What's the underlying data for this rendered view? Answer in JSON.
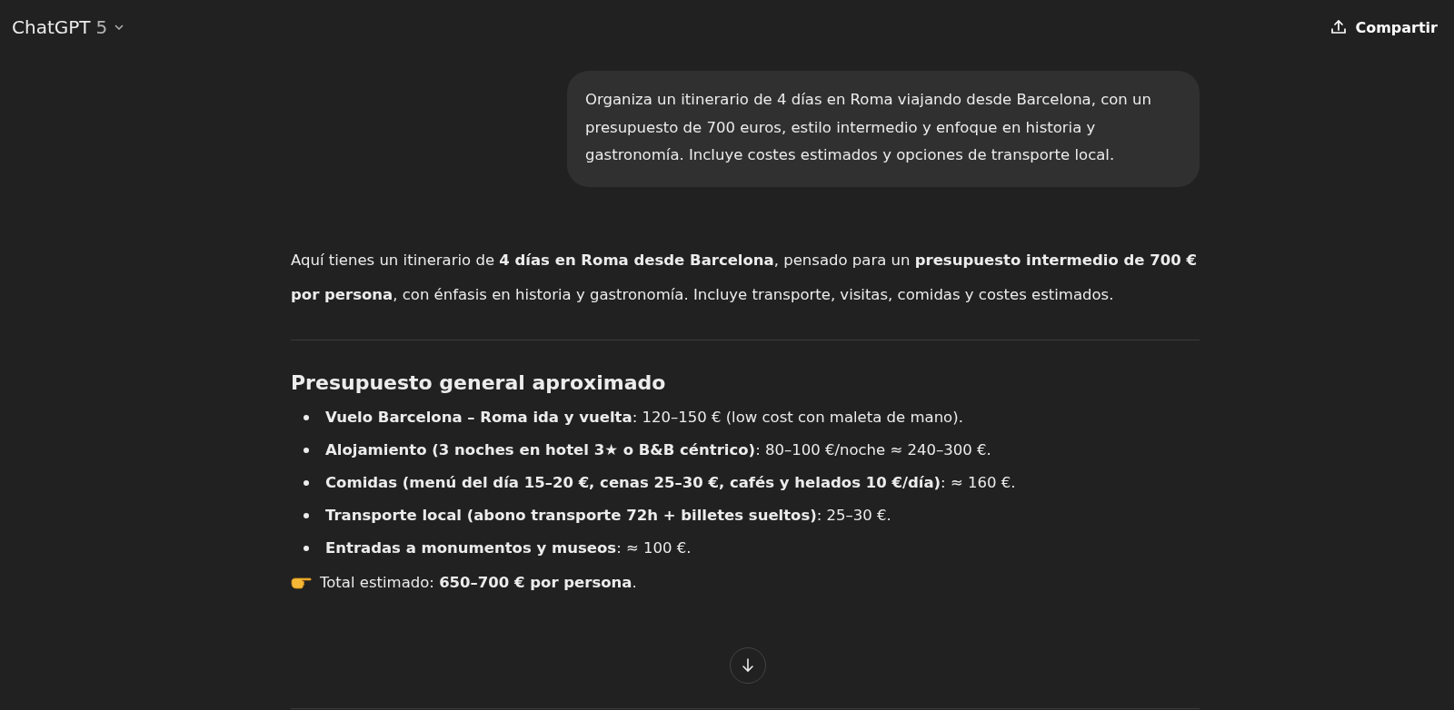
{
  "header": {
    "model_name": "ChatGPT",
    "model_version": "5",
    "share_button": "Compartir"
  },
  "user_message": "Organiza un itinerario de 4 días en Roma viajando desde Barcelona, con un presupuesto de 700 euros, estilo intermedio y enfoque en historia y gastronomía. Incluye costes estimados y opciones de transporte local.",
  "assistant_message": {
    "intro": "Aquí tienes un itinerario de **4 días en Roma desde Barcelona**, pensado para un **presupuesto intermedio de 700 € por persona**, con énfasis en historia y gastronomía. Incluye transporte, visitas, comidas y costes estimados.",
    "section_title": "Presupuesto general aproximado",
    "items": [
      "**Vuelo Barcelona – Roma ida y vuelta**: 120–150 € (low cost con maleta de mano).",
      "**Alojamiento (3 noches en hotel 3★ o B&B céntrico)**: 80–100 €/noche ≈ 240–300 €.",
      "**Comidas (menú del día 15–20 €, cenas 25–30 €, cafés y helados 10 €/día)**: ≈ 160 €.",
      "**Transporte local (abono transporte 72h + billetes sueltos)**: 25–30 €.",
      "**Entradas a monumentos y museos**: ≈ 100 €."
    ],
    "total": "Total estimado: **650–700 € por persona**."
  }
}
